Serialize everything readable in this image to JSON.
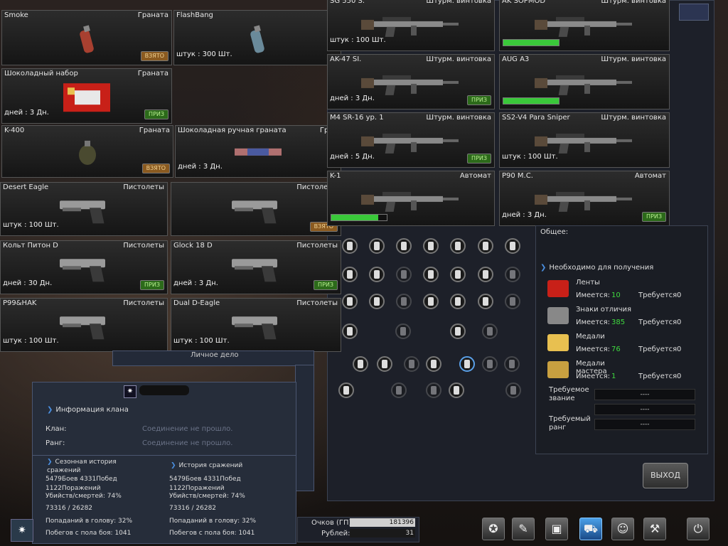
{
  "inventory_left": [
    {
      "name": "Smoke",
      "category": "Граната",
      "duration": "",
      "tag": "ВЗЯТО",
      "tag_type": "taken",
      "icon": "smoke-grenade-icon"
    },
    {
      "name": "FlashBang",
      "category": "",
      "duration": "штук : 300 Шт.",
      "tag": "",
      "tag_type": "",
      "icon": "flashbang-icon"
    },
    {
      "name": "Шоколадный набор",
      "category": "Граната",
      "duration": "дней : 3 Дн.",
      "tag": "ПРИЗ",
      "tag_type": "prize",
      "icon": "chocolate-box-icon"
    },
    {
      "name": "K-400",
      "category": "Граната",
      "duration": "",
      "tag": "ВЗЯТО",
      "tag_type": "taken",
      "icon": "k400-grenade-icon"
    },
    {
      "name": "Шоколадная ручная граната",
      "category": "Гран",
      "duration": "дней : 3 Дн.",
      "tag": "",
      "tag_type": "",
      "icon": "chocolate-grenade-icon"
    },
    {
      "name": "Desert Eagle",
      "category": "Пистолеты",
      "duration": "штук : 100 Шт.",
      "tag": "",
      "tag_type": "",
      "icon": "desert-eagle-icon"
    },
    {
      "name": "",
      "category": "Пистолеты",
      "duration": "",
      "tag": "ВЗЯТО",
      "tag_type": "taken",
      "icon": "pistol-icon"
    },
    {
      "name": "Кольт Питон D",
      "category": "Пистолеты",
      "duration": "дней : 30 Дн.",
      "tag": "ПРИЗ",
      "tag_type": "prize",
      "icon": "revolver-icon"
    },
    {
      "name": "Glock 18 D",
      "category": "Пистолеты",
      "duration": "дней : 3 Дн.",
      "tag": "ПРИЗ",
      "tag_type": "prize",
      "icon": "glock-icon"
    },
    {
      "name": "P99&HAK",
      "category": "Пистолеты",
      "duration": "штук : 100 Шт.",
      "tag": "",
      "tag_type": "",
      "icon": "p99-icon"
    },
    {
      "name": "Dual D-Eagle",
      "category": "Пистолеты",
      "duration": "штук : 100 Шт.",
      "tag": "",
      "tag_type": "",
      "icon": "dual-eagle-icon"
    }
  ],
  "inventory_right": [
    {
      "name": "SG 550 S.",
      "category": "Штурм. винтовка",
      "duration": "штук : 100 Шт.",
      "tag": "",
      "tag_type": "",
      "bar": null,
      "icon": "sg550-icon"
    },
    {
      "name": "AK SOPMOD",
      "category": "Штурм. винтовка",
      "duration": "",
      "tag": "",
      "tag_type": "",
      "bar": 1.0,
      "icon": "ak-sopmod-icon"
    },
    {
      "name": "AK-47 SI.",
      "category": "Штурм. винтовка",
      "duration": "дней : 3 Дн.",
      "tag": "ПРИЗ",
      "tag_type": "prize",
      "bar": null,
      "icon": "ak47-icon"
    },
    {
      "name": "AUG A3",
      "category": "Штурм. винтовка",
      "duration": "",
      "tag": "",
      "tag_type": "",
      "bar": 1.0,
      "icon": "aug-icon"
    },
    {
      "name": "M4 SR-16 ур. 1",
      "category": "Штурм. винтовка",
      "duration": "дней : 5 Дн.",
      "tag": "ПРИЗ",
      "tag_type": "prize",
      "bar": null,
      "icon": "m4-icon"
    },
    {
      "name": "SS2-V4 Para Sniper",
      "category": "Штурм. винтовка",
      "duration": "штук : 100 Шт.",
      "tag": "",
      "tag_type": "",
      "bar": null,
      "icon": "sniper-icon"
    },
    {
      "name": "K-1",
      "category": "Автомат",
      "duration": "",
      "tag": "",
      "tag_type": "",
      "bar": 0.85,
      "icon": "k1-icon"
    },
    {
      "name": "P90 M.C.",
      "category": "Автомат",
      "duration": "дней : 3 Дн.",
      "tag": "ПРИЗ",
      "tag_type": "prize",
      "bar": null,
      "icon": "p90-icon"
    }
  ],
  "requirements": {
    "general_label": "Общее:",
    "header": "Необходимо для получения",
    "items": [
      {
        "label": "Ленты",
        "have_label": "Имеется:",
        "have": "10",
        "need_label": "Требуется",
        "need": "0",
        "icon": "ribbons-icon"
      },
      {
        "label": "Знаки отличия",
        "have_label": "Имеется:",
        "have": "385",
        "need_label": "Требуется",
        "need": "0",
        "icon": "insignia-icon"
      },
      {
        "label": "Медали",
        "have_label": "Имеется:",
        "have": "76",
        "need_label": "Требуется",
        "need": "0",
        "icon": "medal-icon"
      },
      {
        "label": "Медали мастера",
        "have_label": "Имеется:",
        "have": "1",
        "need_label": "Требуется",
        "need": "0",
        "icon": "master-medal-icon"
      }
    ],
    "req_title_label": "Требуемое звание",
    "req_title_value": "----",
    "mid_value": "----",
    "req_rank_label": "Требуемый ранг",
    "req_rank_value": "----",
    "exit_label": "ВЫХОД"
  },
  "clan": {
    "personal_file": "Личное дело",
    "clan_info_header": "Информация клана",
    "clan_label": "Клан:",
    "clan_value": "Соединение не прошло.",
    "rank_label": "Ранг:",
    "rank_value": "Соединение не прошло.",
    "season_header": "Сезонная история сражений",
    "battle_header": "История сражений",
    "season_stats": {
      "battles": "5479Боев 4331Побед",
      "losses": "1122Поражений",
      "kd": "Убийств/смертей: 74%",
      "kills": "73316 / 26282",
      "headshots": "Попаданий в голову: 32%",
      "escapes": "Побегов с пола боя: 1041"
    },
    "battle_stats": {
      "battles": "5479Боев 4331Побед",
      "losses": "1122Поражений",
      "kd": "Убийств/смертей: 74%",
      "kills": "73316 / 26282",
      "headshots": "Попаданий в голову: 32%",
      "escapes": "Побегов с пола боя: 1041"
    }
  },
  "points": {
    "gp_label": "Очков (ГП):",
    "gp_value": "181396",
    "rub_label": "Рублей:",
    "rub_value": "31"
  },
  "bottom_buttons": [
    {
      "name": "emblem-button",
      "icon": "emblem-icon",
      "selected": false
    },
    {
      "name": "missions-button",
      "icon": "clipboard-icon",
      "selected": false
    },
    {
      "name": "inventory-button",
      "icon": "backpack-icon",
      "selected": false
    },
    {
      "name": "shop-button",
      "icon": "cart-icon",
      "selected": true
    },
    {
      "name": "community-button",
      "icon": "people-icon",
      "selected": false
    },
    {
      "name": "settings-button",
      "icon": "wrench-icon",
      "selected": false
    },
    {
      "name": "exit-game-button",
      "icon": "power-icon",
      "selected": false
    }
  ],
  "colors": {
    "accent_green": "#3fd93f",
    "accent_blue": "#4a8fe0",
    "tag_taken": "#8a5a20",
    "tag_prize": "#2c6a1a"
  }
}
